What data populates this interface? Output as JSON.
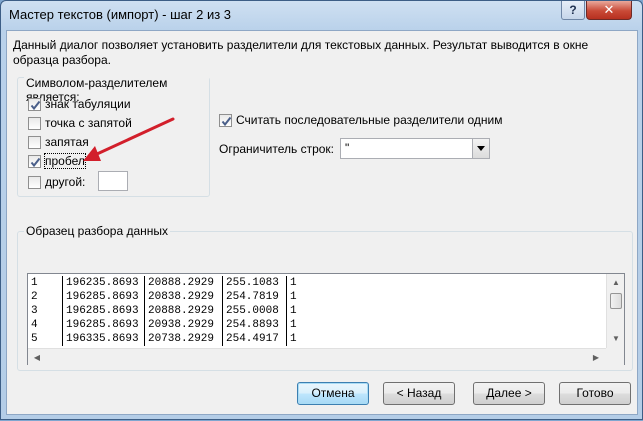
{
  "window": {
    "title": "Мастер текстов (импорт) - шаг 2 из 3",
    "help_label": "?",
    "close_label": "✕"
  },
  "description": "Данный диалог позволяет установить разделители для текстовых данных. Результат выводится в окне образца разбора.",
  "delimiters": {
    "group_label": "Символом-разделителем является:",
    "items": [
      {
        "label": "знак табуляции",
        "checked": true
      },
      {
        "label": "точка с запятой",
        "checked": false
      },
      {
        "label": "запятая",
        "checked": false
      },
      {
        "label": "пробел",
        "checked": true
      },
      {
        "label": "другой:",
        "checked": false
      }
    ],
    "other_value": ""
  },
  "consecutive": {
    "label": "Считать последовательные разделители одним",
    "checked": true
  },
  "qualifier": {
    "label": "Ограничитель строк:",
    "value": "\""
  },
  "preview": {
    "group_label": "Образец разбора данных",
    "rows": [
      [
        "1",
        "196235.8693",
        "20888.2929",
        "255.1083",
        "1"
      ],
      [
        "2",
        "196285.8693",
        "20838.2929",
        "254.7819",
        "1"
      ],
      [
        "3",
        "196285.8693",
        "20888.2929",
        "255.0008",
        "1"
      ],
      [
        "4",
        "196285.8693",
        "20938.2929",
        "254.8893",
        "1"
      ],
      [
        "5",
        "196335.8693",
        "20738.2929",
        "254.4917",
        "1"
      ]
    ]
  },
  "buttons": {
    "cancel": "Отмена",
    "back": "< Назад",
    "next": "Далее >",
    "finish": "Готово"
  },
  "colors": {
    "annotation_arrow": "#d21f2b"
  }
}
